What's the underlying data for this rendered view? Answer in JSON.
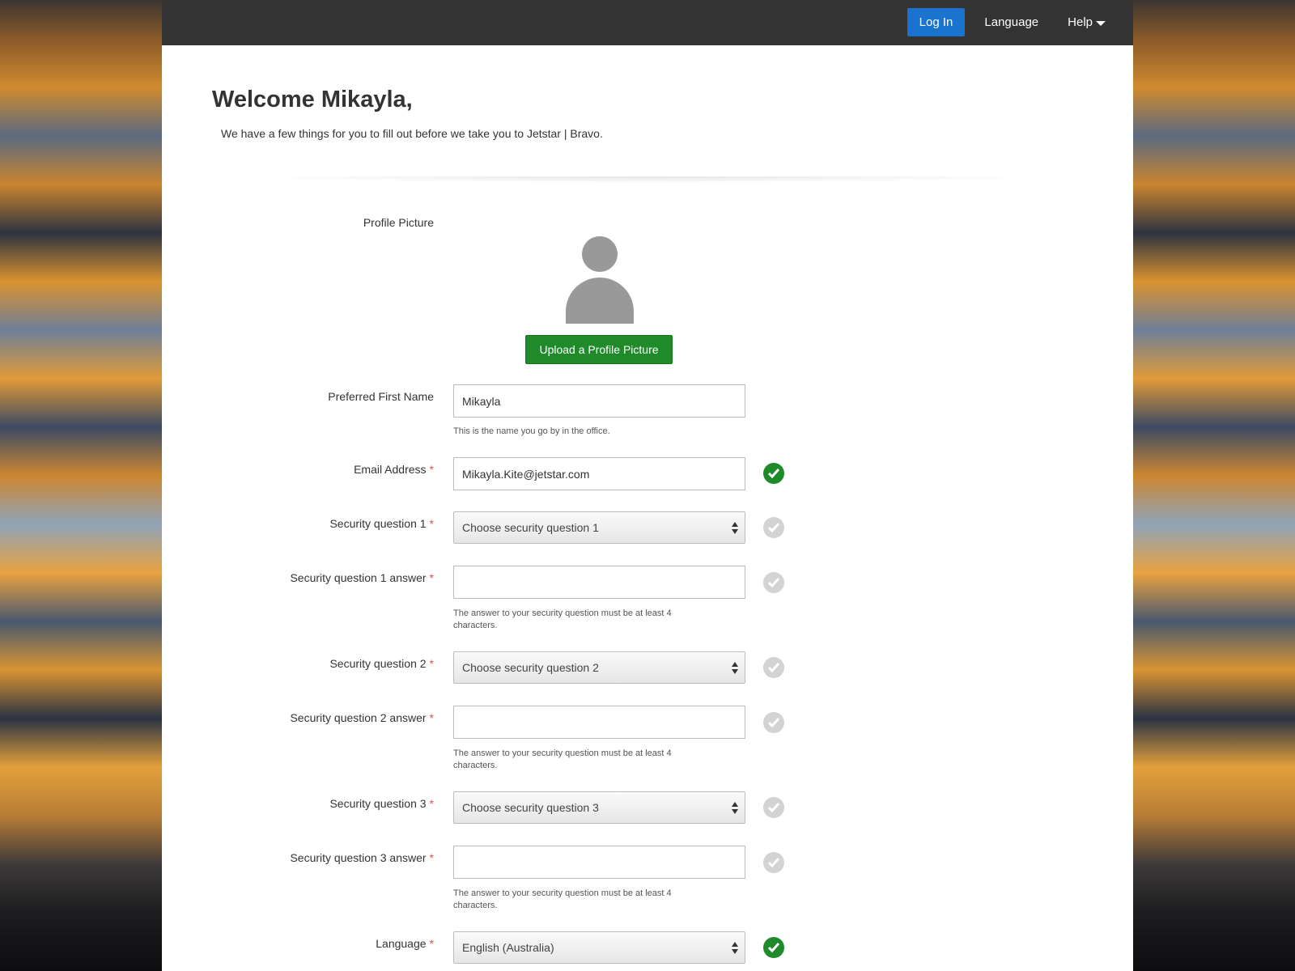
{
  "topbar": {
    "login_label": "Log In",
    "language_label": "Language",
    "help_label": "Help"
  },
  "header": {
    "welcome": "Welcome Mikayla,",
    "intro": "We have a few things for you to fill out before we take you to Jetstar | Bravo."
  },
  "profile": {
    "label": "Profile Picture",
    "upload_label": "Upload a Profile Picture"
  },
  "form": {
    "preferred_name": {
      "label": "Preferred First Name",
      "value": "Mikayla",
      "help": "This is the name you go by in the office."
    },
    "email": {
      "label": "Email Address",
      "value": "Mikayla.Kite@jetstar.com",
      "status": "valid"
    },
    "q1": {
      "label": "Security question 1",
      "selected": "Choose security question 1"
    },
    "q1_answer": {
      "label": "Security question 1 answer",
      "value": "",
      "help": "The answer to your security question must be at least 4 characters."
    },
    "q2": {
      "label": "Security question 2",
      "selected": "Choose security question 2"
    },
    "q2_answer": {
      "label": "Security question 2 answer",
      "value": "",
      "help": "The answer to your security question must be at least 4 characters."
    },
    "q3": {
      "label": "Security question 3",
      "selected": "Choose security question 3"
    },
    "q3_answer": {
      "label": "Security question 3 answer",
      "value": "",
      "help": "The answer to your security question must be at least 4 characters."
    },
    "language": {
      "label": "Language",
      "selected": "English (Australia)",
      "status": "valid"
    },
    "required_marker": "*"
  },
  "colors": {
    "topbar": "#333333",
    "primary_button": "#1a73cf",
    "success": "#1e8a2a",
    "pending": "#d3d3d3",
    "required": "#d9534f"
  }
}
